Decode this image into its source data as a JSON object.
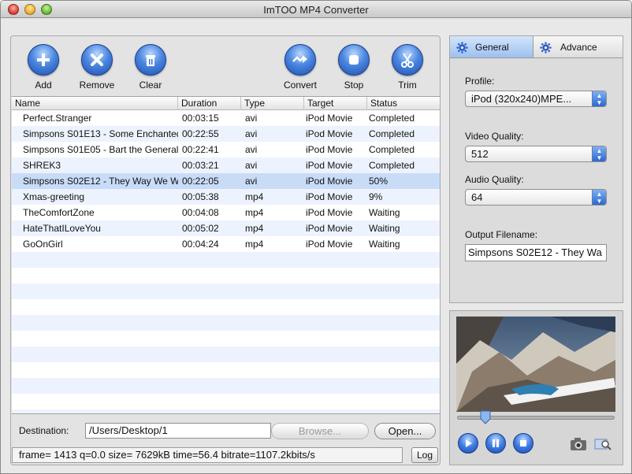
{
  "window": {
    "title": "ImTOO MP4 Converter"
  },
  "toolbar": {
    "add": "Add",
    "remove": "Remove",
    "clear": "Clear",
    "convert": "Convert",
    "stop": "Stop",
    "trim": "Trim"
  },
  "table": {
    "headers": {
      "name": "Name",
      "duration": "Duration",
      "type": "Type",
      "target": "Target",
      "status": "Status"
    },
    "rows": [
      {
        "name": "Perfect.Stranger",
        "duration": "00:03:15",
        "type": "avi",
        "target": "iPod Movie",
        "status": "Completed"
      },
      {
        "name": "Simpsons S01E13 - Some Enchanted",
        "duration": "00:22:55",
        "type": "avi",
        "target": "iPod Movie",
        "status": "Completed"
      },
      {
        "name": "Simpsons S01E05 - Bart the General",
        "duration": "00:22:41",
        "type": "avi",
        "target": "iPod Movie",
        "status": "Completed"
      },
      {
        "name": "SHREK3",
        "duration": "00:03:21",
        "type": "avi",
        "target": "iPod Movie",
        "status": "Completed"
      },
      {
        "name": "Simpsons S02E12 - They Way We W",
        "duration": "00:22:05",
        "type": "avi",
        "target": "iPod Movie",
        "status": "50%"
      },
      {
        "name": "Xmas-greeting",
        "duration": "00:05:38",
        "type": "mp4",
        "target": "iPod Movie",
        "status": "9%"
      },
      {
        "name": "TheComfortZone",
        "duration": "00:04:08",
        "type": "mp4",
        "target": "iPod Movie",
        "status": "Waiting"
      },
      {
        "name": "HateThatILoveYou",
        "duration": "00:05:02",
        "type": "mp4",
        "target": "iPod Movie",
        "status": "Waiting"
      },
      {
        "name": "GoOnGirl",
        "duration": "00:04:24",
        "type": "mp4",
        "target": "iPod Movie",
        "status": "Waiting"
      }
    ],
    "selected_row": 4
  },
  "destination": {
    "label": "Destination:",
    "value": "/Users/Desktop/1",
    "browse": "Browse...",
    "open": "Open..."
  },
  "statusbar": {
    "text": "frame= 1413 q=0.0 size=    7629kB time=56.4 bitrate=1107.2kbits/s",
    "log": "Log"
  },
  "settings": {
    "tab_general": "General",
    "tab_advance": "Advance",
    "profile_label": "Profile:",
    "profile_value": "iPod (320x240)MPE...",
    "video_quality_label": "Video Quality:",
    "video_quality_value": "512",
    "audio_quality_label": "Audio Quality:",
    "audio_quality_value": "64",
    "output_filename_label": "Output Filename:",
    "output_filename_value": "Simpsons S02E12 - They Wa"
  },
  "player": {
    "seek_position": 0.18
  },
  "colors": {
    "accent": "#2b68d0",
    "selected_row": "#c8dcf8",
    "alt_row": "#edf3fe"
  }
}
